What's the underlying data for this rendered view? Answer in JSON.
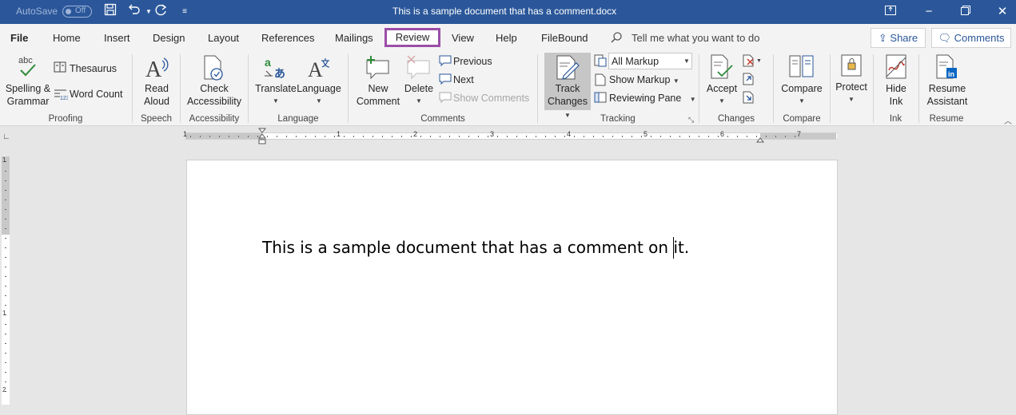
{
  "title_bar": {
    "autosave_label": "AutoSave",
    "autosave_state": "Off",
    "document_title": "This is a sample document that has a comment.docx"
  },
  "tabs": [
    "File",
    "Home",
    "Insert",
    "Design",
    "Layout",
    "References",
    "Mailings",
    "Review",
    "View",
    "Help",
    "FileBound"
  ],
  "active_tab": "Review",
  "tell_me": "Tell me what you want to do",
  "share_label": "Share",
  "comments_label": "Comments",
  "ribbon": {
    "proofing": {
      "spelling_1": "Spelling &",
      "spelling_2": "Grammar",
      "thesaurus": "Thesaurus",
      "word_count": "Word Count",
      "group": "Proofing"
    },
    "speech": {
      "read_1": "Read",
      "read_2": "Aloud",
      "group": "Speech"
    },
    "accessibility": {
      "check_1": "Check",
      "check_2": "Accessibility",
      "group": "Accessibility"
    },
    "language": {
      "translate": "Translate",
      "language": "Language",
      "group": "Language"
    },
    "comments": {
      "new_1": "New",
      "new_2": "Comment",
      "delete": "Delete",
      "previous": "Previous",
      "next": "Next",
      "show": "Show Comments",
      "group": "Comments"
    },
    "tracking": {
      "track_1": "Track",
      "track_2": "Changes",
      "markup_select": "All Markup",
      "show_markup": "Show Markup",
      "reviewing_pane": "Reviewing Pane",
      "group": "Tracking"
    },
    "changes": {
      "accept": "Accept",
      "group": "Changes"
    },
    "compare": {
      "compare": "Compare",
      "group": "Compare"
    },
    "protect": {
      "protect": "Protect"
    },
    "ink": {
      "hide_1": "Hide",
      "hide_2": "Ink",
      "group": "Ink"
    },
    "resume": {
      "resume_1": "Resume",
      "resume_2": "Assistant",
      "group": "Resume"
    }
  },
  "ruler_numbers": [
    "1",
    "1",
    "2",
    "3",
    "4",
    "5",
    "6",
    "7"
  ],
  "vruler_numbers": [
    "1",
    "1",
    "2"
  ],
  "document_text": "This is a sample document that has a comment on it."
}
